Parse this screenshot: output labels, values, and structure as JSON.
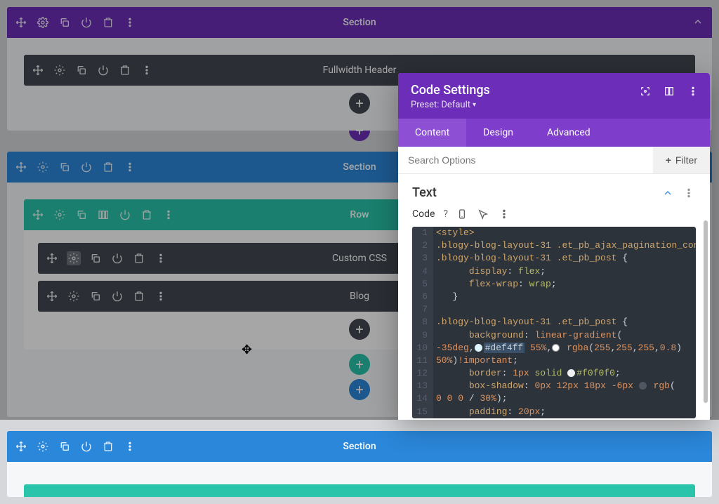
{
  "builder": {
    "sections": [
      {
        "title": "Section",
        "color": "purple",
        "module_title": "Fullwidth Header"
      },
      {
        "title": "Section",
        "color": "blue",
        "row_title": "Row",
        "module_a": "Custom CSS",
        "module_b": "Blog"
      },
      {
        "title": "Section",
        "color": "blue"
      }
    ]
  },
  "modal": {
    "title": "Code Settings",
    "preset_label": "Preset:",
    "preset_value": "Default",
    "tabs": {
      "content": "Content",
      "design": "Design",
      "advanced": "Advanced"
    },
    "search_placeholder": "Search Options",
    "filter_label": "Filter",
    "field_title": "Text",
    "code_label": "Code"
  },
  "code": {
    "class_a": ".blogy-blog-layout-31",
    "class_b": ".et_pb_ajax_pagination_container",
    "class_c": ".et_pb_post",
    "style_open": "<style>",
    "p_display": "display",
    "v_flex": "flex",
    "p_flexwrap": "flex-wrap",
    "v_wrap": "wrap",
    "p_background": "background",
    "v_lineargrad": "linear-gradient",
    "deg": "-35deg",
    "hex1": "#def4ff",
    "pct55": "55%",
    "rgba": "rgba",
    "rgb": "rgb",
    "r255": "255",
    "a08": "0.8",
    "pct50": "50%",
    "important": "!important",
    "p_border": "border",
    "v_1px": "1px",
    "v_solid": "solid",
    "hex2": "#f0f0f0",
    "p_boxshadow": "box-shadow",
    "v_0px": "0px",
    "v_12px": "12px",
    "v_18px": "18px",
    "v_n6px": "-6px",
    "zero": "0",
    "pct30": "30%",
    "p_padding": "padding",
    "v_20px": "20px"
  }
}
